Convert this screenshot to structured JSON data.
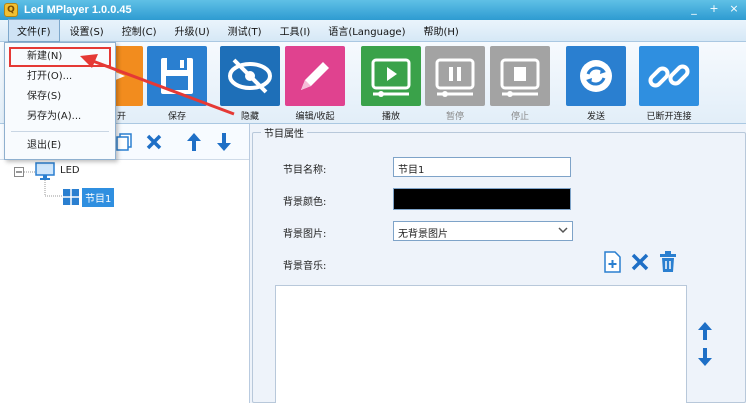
{
  "window": {
    "title": "Led MPlayer 1.0.0.45",
    "icon_label": "Q",
    "controls": [
      "_",
      "+",
      "×"
    ]
  },
  "menubar": {
    "items": [
      {
        "label": "文件(F)"
      },
      {
        "label": "设置(S)"
      },
      {
        "label": "控制(C)"
      },
      {
        "label": "升级(U)"
      },
      {
        "label": "测试(T)"
      },
      {
        "label": "工具(I)"
      },
      {
        "label": "语言(Language)"
      },
      {
        "label": "帮助(H)"
      }
    ]
  },
  "file_menu": {
    "items": [
      {
        "label": "新建(N)"
      },
      {
        "label": "打开(O)..."
      },
      {
        "label": "保存(S)"
      },
      {
        "label": "另存为(A)..."
      },
      {
        "label": "退出(E)"
      }
    ]
  },
  "toolbar": {
    "new_label": "开",
    "save_label": "保存",
    "hide_label": "隐藏",
    "edit_label": "编辑/收起",
    "play_label": "播放",
    "pause_label": "暂停",
    "stop_label": "停止",
    "send_label": "发送",
    "disconnect_label": "已断开连接"
  },
  "tree": {
    "root_label": "LED",
    "child_label": "节目1"
  },
  "properties": {
    "group_title": "节目属性",
    "name_label": "节目名称:",
    "name_value": "节目1",
    "bg_color_label": "背景颜色:",
    "bg_color_value": "#000000",
    "bg_image_label": "背景图片:",
    "bg_image_value": "无背景图片",
    "bg_music_label": "背景音乐:"
  },
  "colors": {
    "titlebar": "#2e9bd1",
    "accent_orange": "#f28c1e",
    "accent_blue": "#2a7fd0",
    "accent_pink": "#e0428f",
    "accent_green": "#3aa24a",
    "disabled_gray": "#9a9a9a",
    "highlight_red": "#e53935"
  }
}
